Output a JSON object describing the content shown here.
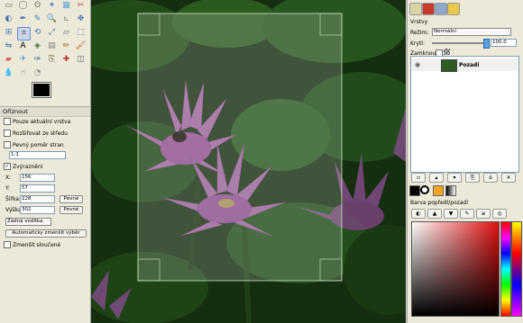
{
  "toolbox": {
    "tools": [
      {
        "name": "rect-select-icon",
        "glyph": "▭"
      },
      {
        "name": "ellipse-select-icon",
        "glyph": "◯"
      },
      {
        "name": "lasso-icon",
        "glyph": "ʘ"
      },
      {
        "name": "fuzzy-select-icon",
        "glyph": "✦"
      },
      {
        "name": "color-select-icon",
        "glyph": "▦"
      },
      {
        "name": "scissors-icon",
        "glyph": "✂"
      },
      {
        "name": "foreground-select-icon",
        "glyph": "◐"
      },
      {
        "name": "paths-icon",
        "glyph": "✒"
      },
      {
        "name": "color-picker-icon",
        "glyph": "✎"
      },
      {
        "name": "zoom-icon",
        "glyph": "🔍"
      },
      {
        "name": "measure-icon",
        "glyph": "⊾"
      },
      {
        "name": "move-icon",
        "glyph": "✥"
      },
      {
        "name": "align-icon",
        "glyph": "⊞"
      },
      {
        "name": "crop-icon",
        "glyph": "⌗"
      },
      {
        "name": "rotate-icon",
        "glyph": "⟲"
      },
      {
        "name": "scale-icon",
        "glyph": "⤢"
      },
      {
        "name": "shear-icon",
        "glyph": "▱"
      },
      {
        "name": "perspective-icon",
        "glyph": "⬚"
      },
      {
        "name": "flip-icon",
        "glyph": "⇋"
      },
      {
        "name": "text-icon",
        "glyph": "A"
      },
      {
        "name": "bucket-fill-icon",
        "glyph": "◈"
      },
      {
        "name": "blend-icon",
        "glyph": "▤"
      },
      {
        "name": "pencil-icon",
        "glyph": "✏"
      },
      {
        "name": "paintbrush-icon",
        "glyph": "🖌"
      },
      {
        "name": "eraser-icon",
        "glyph": "▰"
      },
      {
        "name": "airbrush-icon",
        "glyph": "✈"
      },
      {
        "name": "ink-icon",
        "glyph": "✑"
      },
      {
        "name": "clone-icon",
        "glyph": "⎘"
      },
      {
        "name": "heal-icon",
        "glyph": "✚"
      },
      {
        "name": "perspective-clone-icon",
        "glyph": "◫"
      },
      {
        "name": "blur-icon",
        "glyph": "💧"
      },
      {
        "name": "smudge-icon",
        "glyph": "☝"
      },
      {
        "name": "dodge-burn-icon",
        "glyph": "◔"
      }
    ],
    "accent": "#2b5bb8"
  },
  "tool_options": {
    "title": "Oříznout",
    "current_layer_only": "Pouze aktuální vrstva",
    "expand_from_center": "Rozšiřovat ze středu",
    "fixed_aspect": "Pevný poměr stran",
    "aspect_value": "1:1",
    "highlight": "Zvýraznění",
    "x_label": "X:",
    "x_value": "156",
    "y_label": "Y:",
    "y_value": "57",
    "width_label": "Šířka:",
    "width_value": "228",
    "height_label": "Výška:",
    "height_value": "302",
    "fixed_label": "Pevné",
    "guides_value": "Žádná vodítka",
    "auto_shrink": "Automaticky zmenšit výběr",
    "shrink_merged": "Zmenšit sloučené"
  },
  "layers": {
    "layer_label": "Vrstvy",
    "mode_label": "Režim:",
    "mode_value": "Normální",
    "opacity_label": "Krytí:",
    "opacity_value": "100,0",
    "lock_label": "Zamknout:",
    "layer_name": "Pozadí"
  },
  "colors": {
    "title": "Barva popředí/pozadí",
    "fg": "#000000",
    "bg": "#ffffff"
  }
}
